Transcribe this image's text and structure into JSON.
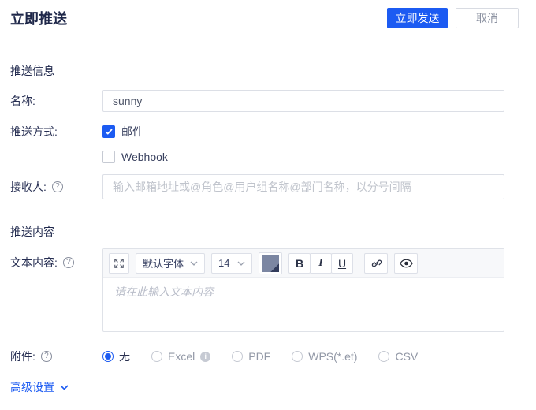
{
  "header": {
    "title": "立即推送",
    "send_label": "立即发送",
    "cancel_label": "取消"
  },
  "sections": {
    "info": "推送信息",
    "content": "推送内容"
  },
  "fields": {
    "name": {
      "label": "名称:",
      "value": "sunny"
    },
    "method": {
      "label": "推送方式:",
      "options": [
        {
          "label": "邮件",
          "checked": true
        },
        {
          "label": "Webhook",
          "checked": false
        }
      ]
    },
    "recipients": {
      "label": "接收人:",
      "placeholder": "输入邮箱地址或@角色@用户组名称@部门名称，以分号间隔"
    },
    "text": {
      "label": "文本内容:",
      "placeholder": "请在此输入文本内容"
    },
    "attachment": {
      "label": "附件:",
      "selected": "无",
      "options": [
        {
          "label": "无"
        },
        {
          "label": "Excel",
          "info": true
        },
        {
          "label": "PDF"
        },
        {
          "label": "WPS(*.et)"
        },
        {
          "label": "CSV"
        }
      ]
    }
  },
  "editor": {
    "font_family": "默认字体",
    "font_size": "14",
    "bold": "B",
    "italic": "I",
    "underline": "U"
  },
  "advanced": {
    "label": "高级设置"
  },
  "icons": {
    "help": "?",
    "info": "i"
  },
  "colors": {
    "accent": "#1c5bf2",
    "color_swatch": "#7b86a2",
    "color_swatch_corner": "#323c5c"
  }
}
